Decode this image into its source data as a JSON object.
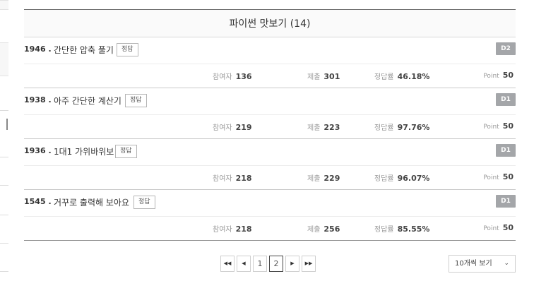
{
  "panel": {
    "title": "파이썬 맛보기 (14)"
  },
  "problems": [
    {
      "number": "1946 .",
      "title": "간단한 압축 풀기",
      "answer_label": "정답",
      "difficulty": "D2",
      "stats": {
        "participants_label": "참여자",
        "participants": "136",
        "submissions_label": "제출",
        "submissions": "301",
        "accuracy_label": "정답률",
        "accuracy": "46.18%",
        "point_label": "Point",
        "point": "50"
      }
    },
    {
      "number": "1938 .",
      "title": "아주 간단한 계산기",
      "answer_label": "정답",
      "difficulty": "D1",
      "stats": {
        "participants_label": "참여자",
        "participants": "219",
        "submissions_label": "제출",
        "submissions": "223",
        "accuracy_label": "정답률",
        "accuracy": "97.76%",
        "point_label": "Point",
        "point": "50"
      }
    },
    {
      "number": "1936 .",
      "title": "1대1 가위바위보",
      "answer_label": "정답",
      "difficulty": "D1",
      "stats": {
        "participants_label": "참여자",
        "participants": "218",
        "submissions_label": "제출",
        "submissions": "229",
        "accuracy_label": "정답률",
        "accuracy": "96.07%",
        "point_label": "Point",
        "point": "50"
      }
    },
    {
      "number": "1545 .",
      "title": "거꾸로 출력해 보아요",
      "answer_label": "정답",
      "difficulty": "D1",
      "stats": {
        "participants_label": "참여자",
        "participants": "218",
        "submissions_label": "제출",
        "submissions": "256",
        "accuracy_label": "정답률",
        "accuracy": "85.55%",
        "point_label": "Point",
        "point": "50"
      }
    }
  ],
  "pagination": {
    "first_icon": "double-chevron-left-icon",
    "prev_icon": "chevron-left-icon",
    "next_icon": "chevron-right-icon",
    "last_icon": "double-chevron-right-icon",
    "pages": [
      "1",
      "2"
    ],
    "current_page": "2"
  },
  "per_page": {
    "selected": "10개씩 보기",
    "icon": "chevron-down-icon"
  }
}
